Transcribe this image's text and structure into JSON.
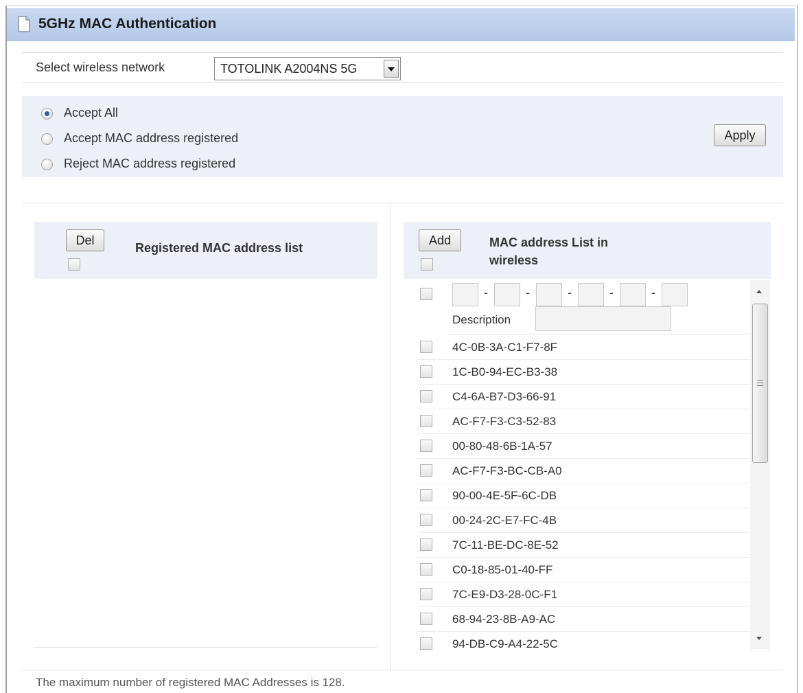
{
  "page": {
    "title": "5GHz MAC Authentication"
  },
  "network": {
    "label": "Select wireless network",
    "selected": "TOTOLINK A2004NS 5G"
  },
  "policy": {
    "options": [
      "Accept All",
      "Accept MAC address registered",
      "Reject MAC address registered"
    ],
    "selected_index": 0,
    "apply_label": "Apply"
  },
  "registered": {
    "del_label": "Del",
    "header": "Registered MAC address list"
  },
  "wireless": {
    "add_label": "Add",
    "header_line1": "MAC address List in",
    "header_line2": "wireless",
    "description_label": "Description",
    "macs": [
      "4C-0B-3A-C1-F7-8F",
      "1C-B0-94-EC-B3-38",
      "C4-6A-B7-D3-66-91",
      "AC-F7-F3-C3-52-83",
      "00-80-48-6B-1A-57",
      "AC-F7-F3-BC-CB-A0",
      "90-00-4E-5F-6C-DB",
      "00-24-2C-E7-FC-4B",
      "7C-11-BE-DC-8E-52",
      "C0-18-85-01-40-FF",
      "7C-E9-D3-28-0C-F1",
      "68-94-23-8B-A9-AC",
      "94-DB-C9-A4-22-5C"
    ]
  },
  "footer": {
    "note": "The maximum number of registered MAC Addresses is 128."
  }
}
